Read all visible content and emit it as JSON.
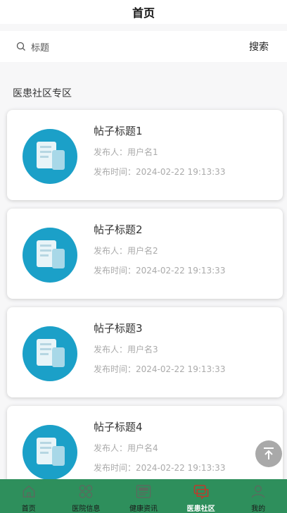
{
  "header": {
    "title": "首页"
  },
  "search": {
    "placeholder": "标题",
    "button_label": "搜索"
  },
  "section": {
    "title": "医患社区专区"
  },
  "posts": [
    {
      "title": "帖子标题1",
      "author": "发布人：用户名1",
      "time": "发布时间：2024-02-22 19:13:33"
    },
    {
      "title": "帖子标题2",
      "author": "发布人：用户名2",
      "time": "发布时间：2024-02-22 19:13:33"
    },
    {
      "title": "帖子标题3",
      "author": "发布人：用户名3",
      "time": "发布时间：2024-02-22 19:13:33"
    },
    {
      "title": "帖子标题4",
      "author": "发布人：用户名4",
      "time": "发布时间：2024-02-22 19:13:33"
    }
  ],
  "tabbar": {
    "items": [
      {
        "label": "首页",
        "icon": "home-icon",
        "active": false
      },
      {
        "label": "医院信息",
        "icon": "grid-icon",
        "active": false
      },
      {
        "label": "健康资讯",
        "icon": "news-icon",
        "active": false
      },
      {
        "label": "医患社区",
        "icon": "chat-icon",
        "active": true
      },
      {
        "label": "我的",
        "icon": "user-icon",
        "active": false
      }
    ]
  },
  "colors": {
    "accent": "#2e8f5c",
    "icon_circle": "#1ba0c8",
    "active_icon": "#c0392b"
  }
}
